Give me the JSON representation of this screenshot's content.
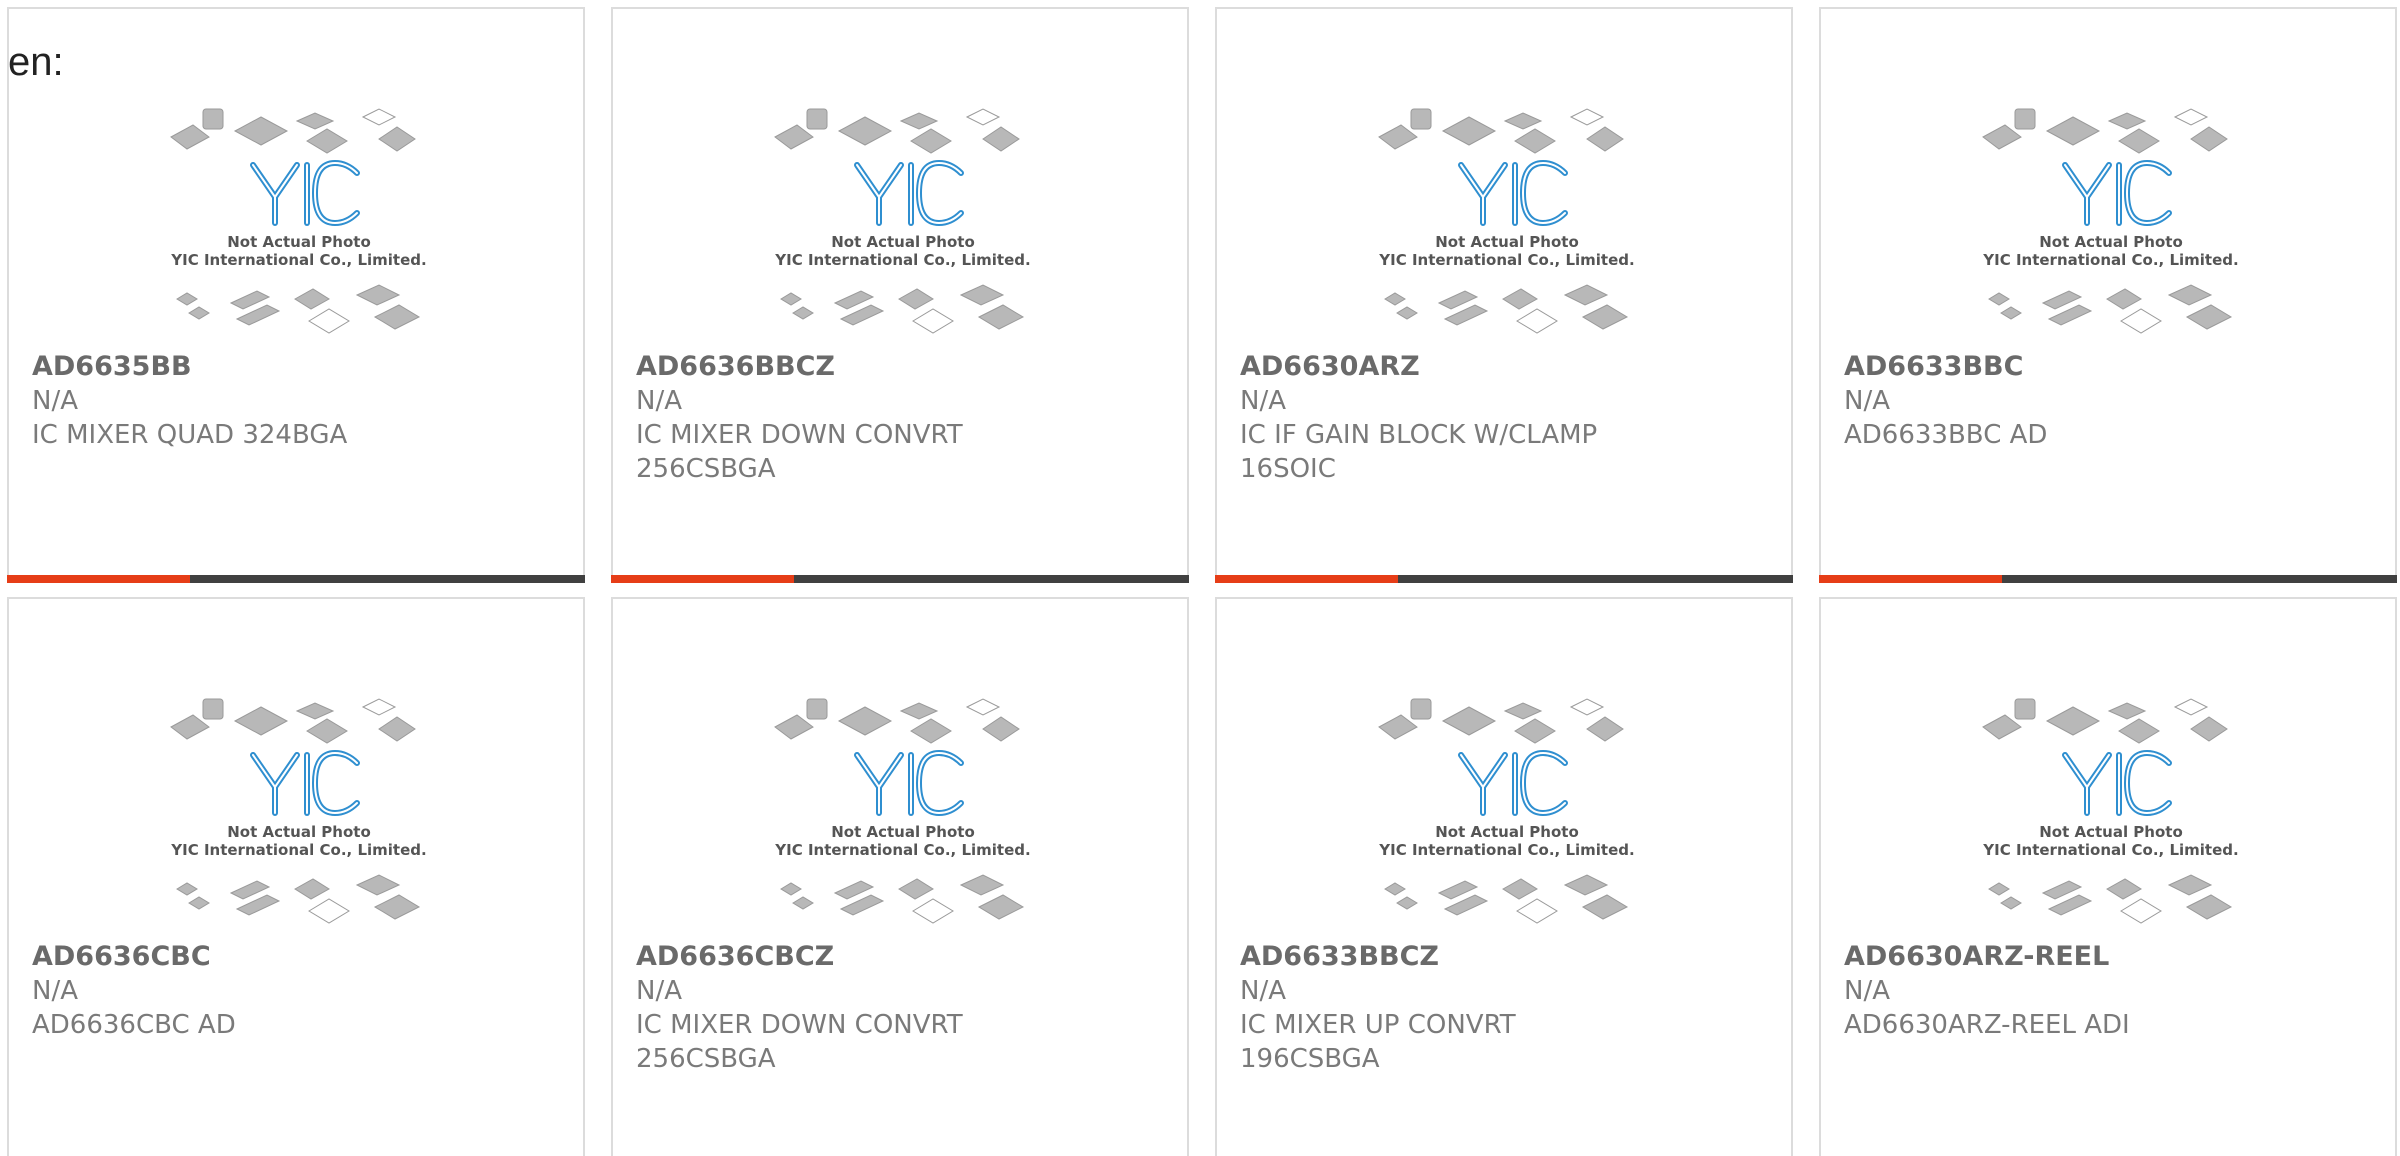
{
  "lang_label": "en:",
  "colors": {
    "accent": "#e63d17",
    "bar": "#404040",
    "logo_blue": "#2f8fd0",
    "chip_gray": "#b8b8b8"
  },
  "placeholder": {
    "line1": "Not Actual Photo",
    "line2": "YIC International Co., Limited.",
    "logo": "YIC"
  },
  "products": [
    {
      "part": "AD6635BB",
      "mfr": "N/A",
      "desc": "IC MIXER QUAD 324BGA"
    },
    {
      "part": "AD6636BBCZ",
      "mfr": "N/A",
      "desc": "IC MIXER DOWN CONVRT 256CSBGA"
    },
    {
      "part": "AD6630ARZ",
      "mfr": "N/A",
      "desc": "IC IF GAIN BLOCK W/CLAMP 16SOIC"
    },
    {
      "part": "AD6633BBC",
      "mfr": "N/A",
      "desc": "AD6633BBC AD"
    },
    {
      "part": "AD6636CBC",
      "mfr": "N/A",
      "desc": "AD6636CBC AD"
    },
    {
      "part": "AD6636CBCZ",
      "mfr": "N/A",
      "desc": "IC MIXER DOWN CONVRT 256CSBGA"
    },
    {
      "part": "AD6633BBCZ",
      "mfr": "N/A",
      "desc": "IC MIXER UP CONVRT 196CSBGA"
    },
    {
      "part": "AD6630ARZ-REEL",
      "mfr": "N/A",
      "desc": "AD6630ARZ-REEL ADI"
    }
  ]
}
